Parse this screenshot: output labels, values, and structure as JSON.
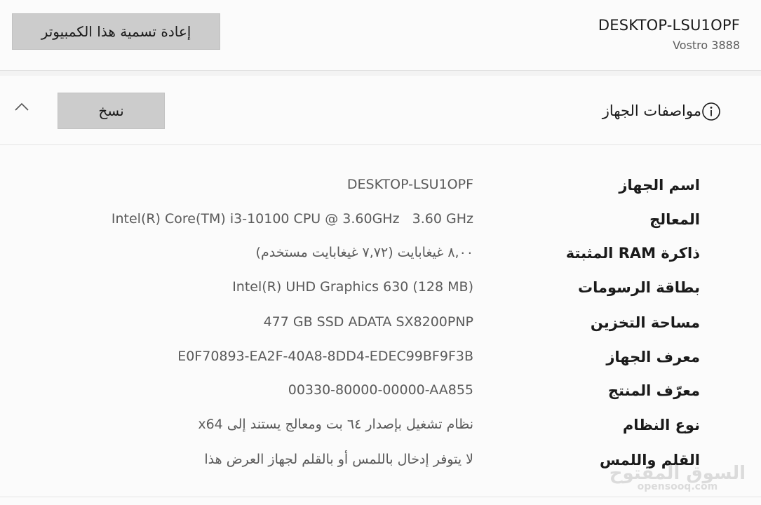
{
  "top_card": {
    "rename_button": "إعادة تسمية هذا الكمبيوتر",
    "device_name": "DESKTOP-LSU1OPF",
    "device_model": "Vostro 3888"
  },
  "specs_card": {
    "title": "مواصفات الجهاز",
    "copy_button": "نسخ",
    "info_icon": "info-icon",
    "chevron_icon": "chevron-up-icon",
    "rows": [
      {
        "label": "اسم الجهاز",
        "value": "DESKTOP-LSU1OPF"
      },
      {
        "label": "المعالج",
        "value": "Intel(R) Core(TM) i3-10100 CPU @ 3.60GHz   3.60 GHz"
      },
      {
        "label": "ذاكرة RAM المثبتة",
        "value": "٨,٠٠ غيغابايت (٧,٧٢ غيغابايت مستخدم)"
      },
      {
        "label": "بطاقة الرسومات",
        "value": "Intel(R) UHD Graphics 630 (128 MB)"
      },
      {
        "label": "مساحة التخزين",
        "value": "477 GB SSD ADATA SX8200PNP"
      },
      {
        "label": "معرف الجهاز",
        "value": "E0F70893-EA2F-40A8-8DD4-EDEC99BF9F3B"
      },
      {
        "label": "معرّف المنتج",
        "value": "00330-80000-00000-AA855"
      },
      {
        "label": "نوع النظام",
        "value": "نظام تشغيل بإصدار ٦٤ بت ومعالج يستند إلى x64"
      },
      {
        "label": "القلم واللمس",
        "value": "لا يتوفر إدخال باللمس أو بالقلم لجهاز العرض هذا"
      }
    ]
  },
  "watermark": {
    "text_ar": "السوق المفتوح",
    "text_en": "opensooq.com"
  }
}
